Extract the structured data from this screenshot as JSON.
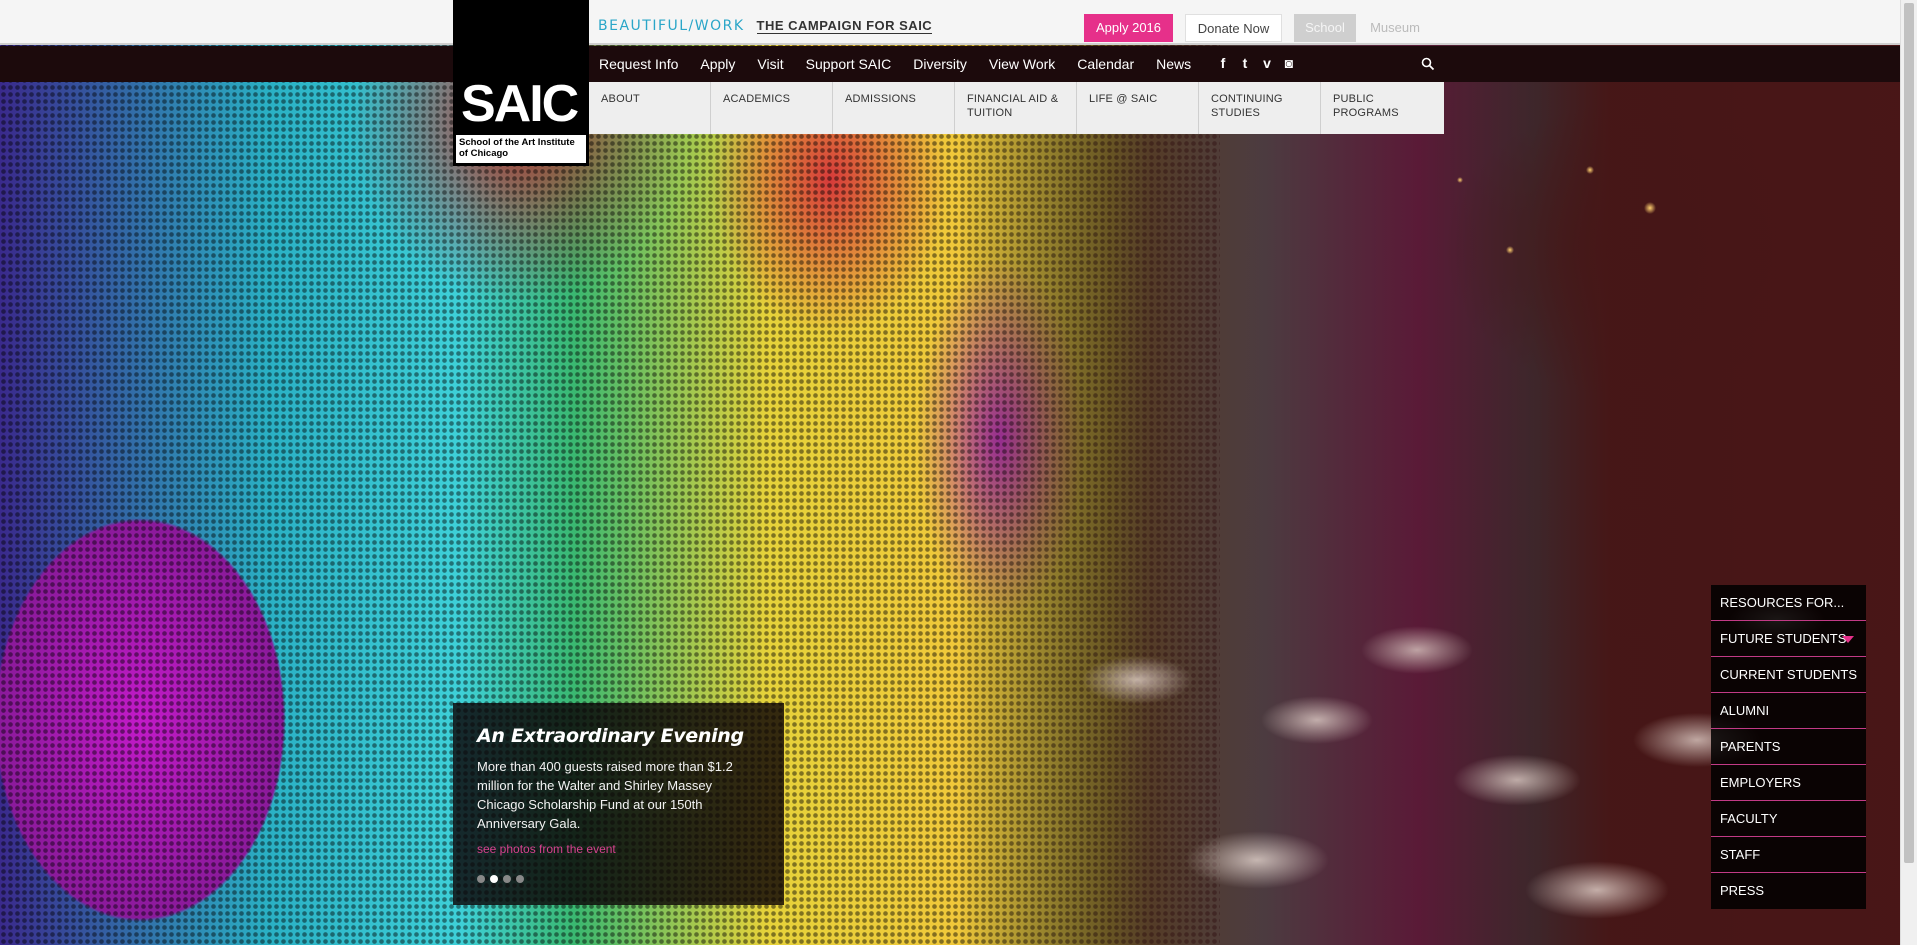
{
  "topbar": {
    "campaign_brand": "BEAUTIFUL/WORK",
    "campaign_text": "THE CAMPAIGN FOR SAIC",
    "apply_label": "Apply 2016",
    "donate_label": "Donate Now",
    "school_label": "School",
    "museum_label": "Museum"
  },
  "logo": {
    "word": "SAIC",
    "subtitle": "School of the Art Institute of Chicago"
  },
  "nav": {
    "links": [
      "Request Info",
      "Apply",
      "Visit",
      "Support SAIC",
      "Diversity",
      "View Work",
      "Calendar",
      "News"
    ],
    "social": [
      {
        "icon": "facebook-icon",
        "glyph": "f"
      },
      {
        "icon": "twitter-icon",
        "glyph": "t"
      },
      {
        "icon": "vimeo-icon",
        "glyph": "v"
      },
      {
        "icon": "instagram-icon",
        "glyph": "◙"
      }
    ]
  },
  "tabs": [
    {
      "label": "About"
    },
    {
      "label": "Academics"
    },
    {
      "label": "Admissions"
    },
    {
      "label": "Financial Aid & Tuition"
    },
    {
      "label": "Life @ SAIC"
    },
    {
      "label": "Continuing Studies"
    },
    {
      "label": "Public Programs"
    }
  ],
  "feature": {
    "title": "An Extraordinary Evening",
    "body": "More than 400 guests raised more than $1.2 million for the Walter and Shirley Massey Chicago Scholarship Fund at our 150th Anniversary Gala.",
    "link": "see photos from the event",
    "slides": 4,
    "active_slide": 2
  },
  "resources": {
    "heading": "RESOURCES FOR...",
    "items": [
      "FUTURE STUDENTS",
      "CURRENT STUDENTS",
      "ALUMNI",
      "PARENTS",
      "EMPLOYERS",
      "FACULTY",
      "STAFF",
      "PRESS"
    ]
  },
  "colors": {
    "accent_pink": "#e6308a",
    "campaign_blue": "#2aa6c8",
    "nav_bg": "#1c0a0c"
  }
}
